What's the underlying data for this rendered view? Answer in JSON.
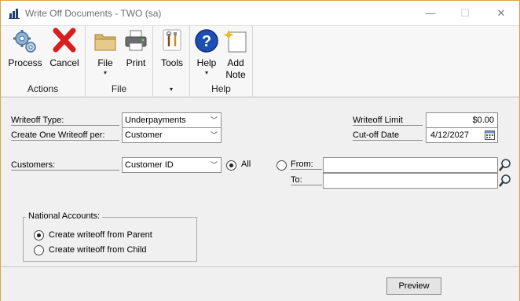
{
  "window": {
    "title": "Write Off Documents  -  TWO (sa)",
    "controls": {
      "minimize": "—",
      "maximize": "☐",
      "close": "✕"
    }
  },
  "ribbon": {
    "groups": [
      {
        "label": "Actions",
        "buttons": [
          {
            "label": "Process",
            "icon": "gears-icon"
          },
          {
            "label": "Cancel",
            "icon": "red-x-icon"
          }
        ]
      },
      {
        "label": "File",
        "buttons": [
          {
            "label": "File",
            "icon": "folder-icon",
            "arrow": "▾"
          },
          {
            "label": "Print",
            "icon": "printer-icon"
          }
        ]
      },
      {
        "label": "",
        "buttons": [
          {
            "label": "Tools",
            "icon": "tools-icon"
          }
        ],
        "expander": "▾"
      },
      {
        "label": "Help",
        "buttons": [
          {
            "label": "Help",
            "icon": "help-icon",
            "arrow": "▾"
          },
          {
            "label": "Add\nNote",
            "icon": "note-icon",
            "line1": "Add",
            "line2": "Note"
          }
        ]
      }
    ]
  },
  "form": {
    "writeoff_type": {
      "label": "Writeoff Type:",
      "value": "Underpayments"
    },
    "create_per": {
      "label": "Create One Writeoff per:",
      "value": "Customer"
    },
    "writeoff_limit": {
      "label": "Writeoff Limit",
      "value": "$0.00"
    },
    "cutoff_date": {
      "label": "Cut-off Date",
      "value": "4/12/2027"
    },
    "customers": {
      "label": "Customers:",
      "field": "Customer ID",
      "range_all": "All",
      "range_from": "From:",
      "to": "To:",
      "selected": "All",
      "from_value": "",
      "to_value": ""
    },
    "national_accounts": {
      "title": "National Accounts:",
      "options": [
        "Create writeoff from Parent",
        "Create writeoff from Child"
      ],
      "selected": "Create writeoff from Parent"
    }
  },
  "footer": {
    "preview_label": "Preview"
  },
  "colors": {
    "frame": "#d9a441",
    "background": "#f0f0f0",
    "ribbon": "#f7f7f7",
    "help_blue": "#1b4fb5",
    "cancel_red": "#d81e1e"
  }
}
